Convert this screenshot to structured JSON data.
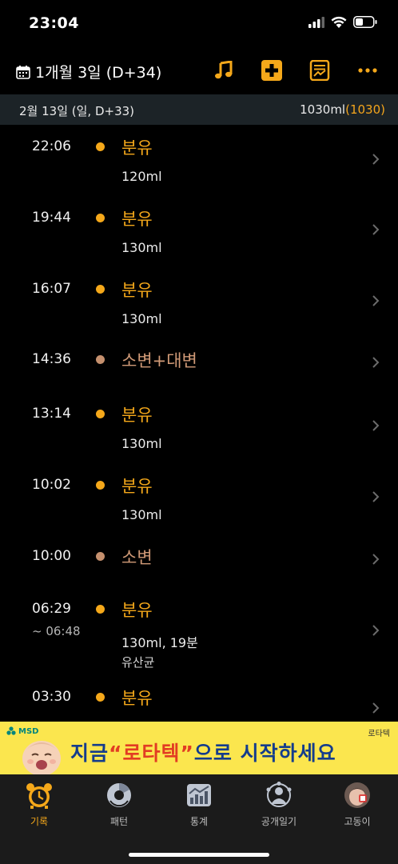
{
  "status": {
    "time": "23:04"
  },
  "nav": {
    "date_title": "1개월 3일 (D+34)",
    "icons": [
      "calendar-icon",
      "music-icon",
      "add-icon",
      "note-icon",
      "more-icon"
    ]
  },
  "day": {
    "title": "2월 13일 (일, D+33)",
    "total_ml": "1030ml",
    "total_paren_open": "(",
    "total_value": "1030",
    "total_paren_close": ")"
  },
  "records": [
    {
      "time": "22:06",
      "end": "",
      "title": "분유",
      "detail": "120ml",
      "extra": "",
      "type": "feed"
    },
    {
      "time": "19:44",
      "end": "",
      "title": "분유",
      "detail": "130ml",
      "extra": "",
      "type": "feed"
    },
    {
      "time": "16:07",
      "end": "",
      "title": "분유",
      "detail": "130ml",
      "extra": "",
      "type": "feed"
    },
    {
      "time": "14:36",
      "end": "",
      "title": "소변+대변",
      "detail": "",
      "extra": "",
      "type": "diaper"
    },
    {
      "time": "13:14",
      "end": "",
      "title": "분유",
      "detail": "130ml",
      "extra": "",
      "type": "feed"
    },
    {
      "time": "10:02",
      "end": "",
      "title": "분유",
      "detail": "130ml",
      "extra": "",
      "type": "feed"
    },
    {
      "time": "10:00",
      "end": "",
      "title": "소변",
      "detail": "",
      "extra": "",
      "type": "diaper"
    },
    {
      "time": "06:29",
      "end": "~ 06:48",
      "title": "분유",
      "detail": "130ml, 19분",
      "extra": "유산균",
      "type": "feed"
    },
    {
      "time": "03:30",
      "end": "",
      "title": "분유",
      "detail": "",
      "extra": "",
      "type": "feed"
    }
  ],
  "banner": {
    "brand": "MSD",
    "product": "로타텍",
    "text_before": "지금",
    "text_highlight": "“로타텍”",
    "text_after": "으로 시작하세요"
  },
  "tabs": [
    {
      "label": "기록",
      "icon": "alarm-clock-icon",
      "active": true
    },
    {
      "label": "패턴",
      "icon": "pattern-chart-icon",
      "active": false
    },
    {
      "label": "통계",
      "icon": "statistics-icon",
      "active": false
    },
    {
      "label": "공개일기",
      "icon": "public-diary-icon",
      "active": false
    },
    {
      "label": "고동이",
      "icon": "baby-profile-icon",
      "active": false
    }
  ],
  "colors": {
    "accent": "#f5a81a",
    "diaper": "#d19a77",
    "header_bg": "#1c2327",
    "banner_bg": "#fbe64e"
  }
}
